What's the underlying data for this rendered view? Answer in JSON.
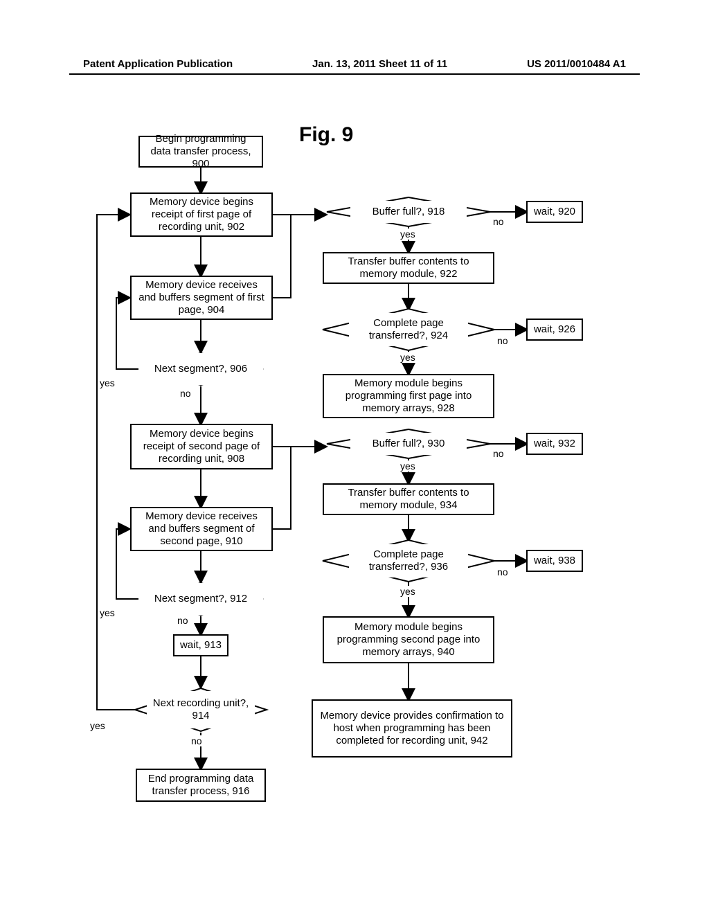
{
  "header": {
    "left": "Patent Application Publication",
    "center": "Jan. 13, 2011  Sheet 11 of 11",
    "right": "US 2011/0010484 A1"
  },
  "figTitle": "Fig. 9",
  "nodes": {
    "n900": "Begin programming data transfer process, 900",
    "n902": "Memory device begins receipt of first page of recording unit, 902",
    "n904": "Memory device receives and buffers segment of first page, 904",
    "d906": "Next segment?, 906",
    "n908": "Memory device begins receipt of second page of recording unit, 908",
    "n910": "Memory device receives and buffers segment of second page, 910",
    "d912": "Next segment?, 912",
    "n913": "wait, 913",
    "d914": "Next recording unit?, 914",
    "n916": "End programming data transfer process, 916",
    "d918": "Buffer full?, 918",
    "n920": "wait, 920",
    "n922": "Transfer buffer contents to memory module, 922",
    "d924": "Complete page transferred?, 924",
    "n926": "wait, 926",
    "n928": "Memory module begins programming first page into memory arrays, 928",
    "d930": "Buffer full?, 930",
    "n932": "wait, 932",
    "n934": "Transfer buffer contents to memory module, 934",
    "d936": "Complete page transferred?, 936",
    "n938": "wait, 938",
    "n940": "Memory module begins programming second page into memory arrays, 940",
    "n942": "Memory device provides confirmation to host when programming has been completed for recording unit, 942"
  },
  "labels": {
    "yes": "yes",
    "no": "no"
  }
}
